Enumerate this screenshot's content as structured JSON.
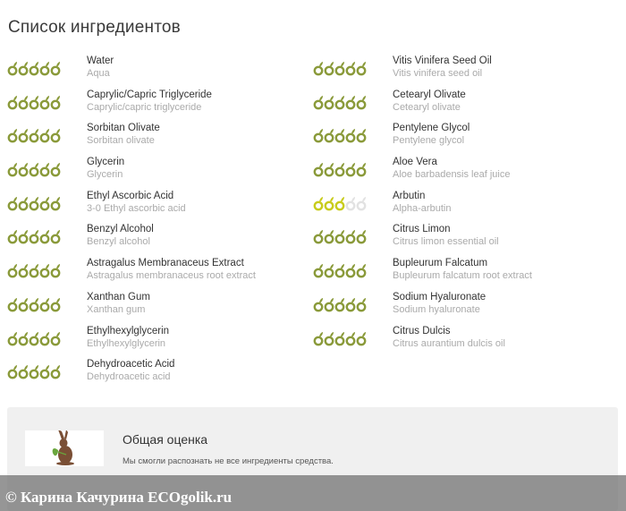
{
  "page": {
    "title": "Список ингредиентов"
  },
  "colors": {
    "good": "#8a9a3a",
    "medium": "#c8cc1c",
    "empty": "#e2e2e2"
  },
  "ingredients_left": [
    {
      "name": "Water",
      "sub": "Aqua",
      "rating": 5,
      "level": "good"
    },
    {
      "name": "Caprylic/Capric Triglyceride",
      "sub": "Caprylic/capric triglyceride",
      "rating": 5,
      "level": "good"
    },
    {
      "name": "Sorbitan Olivate",
      "sub": "Sorbitan olivate",
      "rating": 5,
      "level": "good"
    },
    {
      "name": "Glycerin",
      "sub": "Glycerin",
      "rating": 5,
      "level": "good"
    },
    {
      "name": "Ethyl Ascorbic Acid",
      "sub": "3-0 Ethyl ascorbic acid",
      "rating": 5,
      "level": "good"
    },
    {
      "name": "Benzyl Alcohol",
      "sub": "Benzyl alcohol",
      "rating": 5,
      "level": "good"
    },
    {
      "name": "Astragalus Membranaceus Extract",
      "sub": "Astragalus membranaceus root extract",
      "rating": 5,
      "level": "good"
    },
    {
      "name": "Xanthan Gum",
      "sub": "Xanthan gum",
      "rating": 5,
      "level": "good"
    },
    {
      "name": "Ethylhexylglycerin",
      "sub": "Ethylhexylglycerin",
      "rating": 5,
      "level": "good"
    },
    {
      "name": "Dehydroacetic Acid",
      "sub": "Dehydroacetic acid",
      "rating": 5,
      "level": "good"
    }
  ],
  "ingredients_right": [
    {
      "name": "Vitis Vinifera Seed Oil",
      "sub": "Vitis vinifera seed oil",
      "rating": 5,
      "level": "good"
    },
    {
      "name": "Cetearyl Olivate",
      "sub": "Cetearyl olivate",
      "rating": 5,
      "level": "good"
    },
    {
      "name": "Pentylene Glycol",
      "sub": "Pentylene glycol",
      "rating": 5,
      "level": "good"
    },
    {
      "name": "Aloe Vera",
      "sub": "Aloe barbadensis leaf juice",
      "rating": 5,
      "level": "good"
    },
    {
      "name": "Arbutin",
      "sub": "Alpha-arbutin",
      "rating": 3,
      "level": "medium"
    },
    {
      "name": "Citrus Limon",
      "sub": "Citrus limon essential oil",
      "rating": 5,
      "level": "good"
    },
    {
      "name": "Bupleurum Falcatum",
      "sub": "Bupleurum falcatum root extract",
      "rating": 5,
      "level": "good"
    },
    {
      "name": "Sodium Hyaluronate",
      "sub": "Sodium hyaluronate",
      "rating": 5,
      "level": "good"
    },
    {
      "name": "Citrus Dulcis",
      "sub": "Citrus aurantium dulcis oil",
      "rating": 5,
      "level": "good"
    }
  ],
  "summary": {
    "title": "Общая оценка",
    "note": "Мы смогли распознать не все ингредиенты средства.",
    "logo_icon": "rabbit-icon"
  },
  "watermark": {
    "text": "© Карина Качурина ECOgolik.ru"
  }
}
